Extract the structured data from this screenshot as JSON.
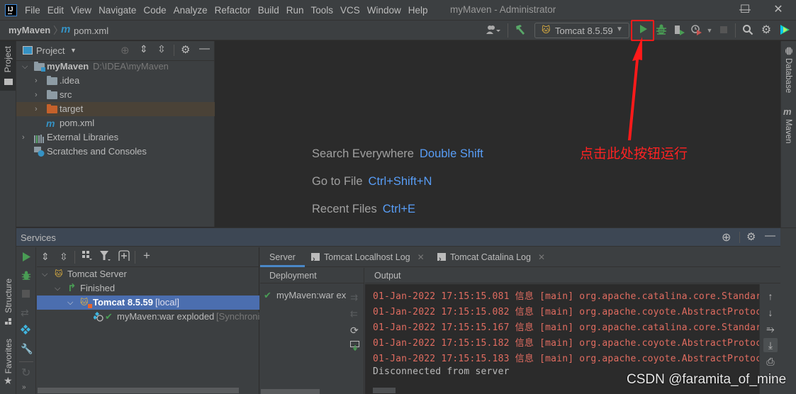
{
  "window": {
    "logo": "IJ",
    "title": "myMaven - Administrator",
    "menu": [
      "File",
      "Edit",
      "View",
      "Navigate",
      "Code",
      "Analyze",
      "Refactor",
      "Build",
      "Run",
      "Tools",
      "VCS",
      "Window",
      "Help"
    ],
    "controls": {
      "minimize": "—",
      "maximize": "☐",
      "close": "✕"
    }
  },
  "navbar": {
    "project": "myMaven",
    "separator": "〉",
    "file_icon": "m",
    "file": "pom.xml"
  },
  "toolbar": {
    "run_config": "Tomcat 8.5.59",
    "icons": [
      "user-icon",
      "build-hammer-icon",
      "run-icon",
      "debug-icon",
      "coverage-icon",
      "profile-icon",
      "stop-icon",
      "search-icon",
      "settings-gear-icon",
      "jetbrains-toolbox-icon"
    ]
  },
  "left_strip": {
    "project_tab": "Project",
    "structure_tab": "Structure",
    "favorites_tab": "Favorites"
  },
  "right_strip": {
    "database_tab": "Database",
    "maven_tab": "Maven"
  },
  "project_panel": {
    "title": "Project",
    "tree": [
      {
        "label": "myMaven",
        "path": "D:\\IDEA\\myMaven",
        "type": "module",
        "expanded": true
      },
      {
        "label": ".idea",
        "type": "folder"
      },
      {
        "label": "src",
        "type": "folder"
      },
      {
        "label": "target",
        "type": "excluded-folder",
        "highlighted": true
      },
      {
        "label": "pom.xml",
        "type": "maven-file"
      },
      {
        "label": "External Libraries",
        "type": "libraries"
      },
      {
        "label": "Scratches and Consoles",
        "type": "scratches"
      }
    ]
  },
  "editor": {
    "hints": [
      {
        "label": "Search Everywhere",
        "shortcut": "Double Shift"
      },
      {
        "label": "Go to File",
        "shortcut": "Ctrl+Shift+N"
      },
      {
        "label": "Recent Files",
        "shortcut": "Ctrl+E"
      }
    ],
    "annotation": "点击此处按钮运行",
    "annotation_color": "#ff2222"
  },
  "services": {
    "title": "Services",
    "tree": [
      {
        "label": "Tomcat Server"
      },
      {
        "label": "Finished"
      },
      {
        "label": "Tomcat 8.5.59",
        "suffix": "[local]",
        "selected": true
      },
      {
        "label": "myMaven:war exploded",
        "suffix": "[Synchroni"
      }
    ],
    "tabs": [
      {
        "label": "Server",
        "active": true
      },
      {
        "label": "Tomcat Localhost Log",
        "closable": true
      },
      {
        "label": "Tomcat Catalina Log",
        "closable": true
      }
    ],
    "deployment": {
      "header": "Deployment",
      "items": [
        "myMaven:war ex"
      ]
    },
    "output": {
      "header": "Output",
      "lines": [
        "01-Jan-2022 17:15:15.081 信息 [main] org.apache.catalina.core.Standar",
        "01-Jan-2022 17:15:15.082 信息 [main] org.apache.coyote.AbstractProtoc",
        "01-Jan-2022 17:15:15.167 信息 [main] org.apache.catalina.core.Standar",
        "01-Jan-2022 17:15:15.182 信息 [main] org.apache.coyote.AbstractProtoc",
        "01-Jan-2022 17:15:15.183 信息 [main] org.apache.coyote.AbstractProtoc"
      ],
      "final_line": "Disconnected from server"
    }
  },
  "watermark": "CSDN @faramita_of_mine",
  "colors": {
    "accent_blue": "#4b6eaf",
    "run_green": "#499c54",
    "log_red": "#e06c60",
    "shortcut_blue": "#589df6",
    "highlight_red": "#ff1a1a"
  }
}
